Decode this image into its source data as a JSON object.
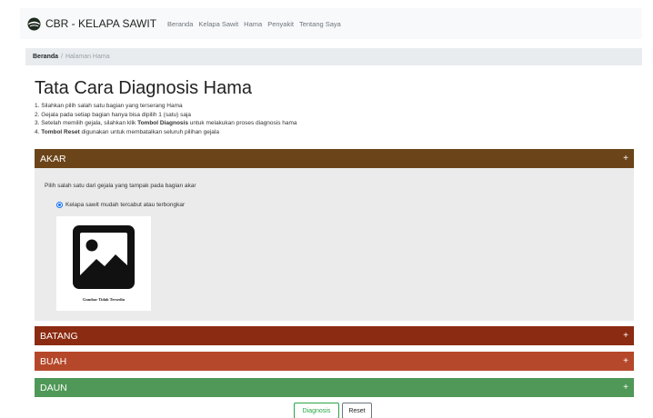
{
  "navbar": {
    "brand_text": "CBR - KELAPA SAWIT",
    "brand_icon": "palm-oil-logo-icon",
    "links": [
      "Beranda",
      "Kelapa Sawit",
      "Hama",
      "Penyakit",
      "Tentang Saya"
    ]
  },
  "breadcrumb": {
    "home": "Beranda",
    "separator": "/",
    "current": "Halaman Hama"
  },
  "page": {
    "title": "Tata Cara Diagnosis Hama",
    "instructions": [
      {
        "prefix": "1. ",
        "bold": "",
        "text": "Silahkan pilih salah satu bagian yang terserang Hama"
      },
      {
        "prefix": "2. ",
        "bold": "",
        "text": "Gejala pada setiap bagian hanya bisa dipilih 1 (satu) saja"
      },
      {
        "prefix": "3. Setelah memilih gejala, silahkan klik ",
        "bold": "Tombol Diagnosis",
        "text": " untuk melakukan proses diagnosis hama"
      },
      {
        "prefix": "4. ",
        "bold": "Tombol Reset",
        "text": " digunakan untuk membatalkan seluruh pilihan gejala"
      }
    ]
  },
  "panels": {
    "akar": {
      "title": "AKAR",
      "toggle": "+",
      "prompt": "Pilih salah satu dari gejala yang tampak pada bagian akar",
      "option_label": "Kelapa sawit mudah tercabut atau terbongkar",
      "option_selected": true,
      "image_icon": "image-placeholder-icon",
      "image_caption": "Gambar Tidak Tersedia",
      "color": "#6b4419"
    },
    "batang": {
      "title": "BATANG",
      "toggle": "+",
      "color": "#8b2b11"
    },
    "buah": {
      "title": "BUAH",
      "toggle": "+",
      "color": "#b5482a"
    },
    "daun": {
      "title": "DAUN",
      "toggle": "+",
      "color": "#4f9857"
    }
  },
  "buttons": {
    "diagnosis": "Diagnosis",
    "reset": "Reset"
  }
}
